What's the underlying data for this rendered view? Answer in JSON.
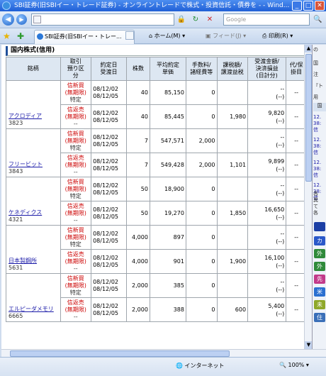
{
  "window": {
    "title": "SBI証券(旧SBIイー・トレード証券) - オンライントレードで株式・投資信託・債券を - - Wind...",
    "min_label": "_",
    "max_label": "□",
    "close_label": "✕"
  },
  "toolbar": {
    "back_icon": "◀",
    "forward_icon": "▶",
    "address_value": "",
    "lock_icon": "🔒",
    "refresh_icon": "↻",
    "stop_icon": "✕",
    "search_placeholder": "Google",
    "search_icon": "🔍"
  },
  "tabs": {
    "fav_star": "★",
    "fav_add": "✚",
    "active_tab_label": "SBI証券(旧SBIイー・トレー...",
    "home_label": "ホーム(M)",
    "feed_label": "フィード(J)",
    "print_label": "印刷(R)"
  },
  "section": {
    "title": "国内株式(信用)"
  },
  "table": {
    "headers": {
      "name": "銘柄",
      "kind": "取引\n預り区\n分",
      "date": "約定日\n受渡日",
      "qty": "株数",
      "avg": "平均約定\n単価",
      "fee": "手数料/\n諸経費等",
      "tax": "課税額/\n譲渡益税",
      "pl": "受渡金額/\n決済損益\n(日計分)",
      "agent": "代/保\n掛目"
    },
    "rows": [
      {
        "name": "アクロディア",
        "code": "3823",
        "kind1": "信新買",
        "kind2": "(無期限)",
        "kind3": "特定",
        "date1": "08/12/02",
        "date2": "08/12/05",
        "qty": "40",
        "avg": "85,150",
        "fee": "0",
        "tax": "",
        "pl1": "--",
        "pl2": "(--)",
        "agent": "--"
      },
      {
        "name": "",
        "code": "",
        "kind1": "信返売",
        "kind2": "(無期限)",
        "kind3": "--",
        "date1": "08/12/02",
        "date2": "08/12/05",
        "qty": "40",
        "avg": "85,445",
        "fee": "0",
        "tax": "1,980",
        "pl1": "9,820",
        "pl2": "(--)",
        "agent": "--"
      },
      {
        "name": "フリービット",
        "code": "3843",
        "kind1": "信新買",
        "kind2": "(無期限)",
        "kind3": "特定",
        "date1": "08/12/02",
        "date2": "08/12/05",
        "qty": "7",
        "avg": "547,571",
        "fee": "2,000",
        "tax": "",
        "pl1": "--",
        "pl2": "(--)",
        "agent": "--"
      },
      {
        "name": "",
        "code": "",
        "kind1": "信返売",
        "kind2": "(無期限)",
        "kind3": "--",
        "date1": "08/12/02",
        "date2": "08/12/05",
        "qty": "7",
        "avg": "549,428",
        "fee": "2,000",
        "tax": "1,101",
        "pl1": "9,899",
        "pl2": "(--)",
        "agent": "--"
      },
      {
        "name": "ケネディクス",
        "code": "4321",
        "kind1": "信新買",
        "kind2": "(無期限)",
        "kind3": "特定",
        "date1": "08/12/02",
        "date2": "08/12/05",
        "qty": "50",
        "avg": "18,900",
        "fee": "0",
        "tax": "",
        "pl1": "--",
        "pl2": "(--)",
        "agent": "--"
      },
      {
        "name": "",
        "code": "",
        "kind1": "信返売",
        "kind2": "(無期限)",
        "kind3": "--",
        "date1": "08/12/02",
        "date2": "08/12/05",
        "qty": "50",
        "avg": "19,270",
        "fee": "0",
        "tax": "1,850",
        "pl1": "16,650",
        "pl2": "(--)",
        "agent": "--"
      },
      {
        "name": "日本製鋼所",
        "code": "5631",
        "kind1": "信新買",
        "kind2": "(無期限)",
        "kind3": "特定",
        "date1": "08/12/02",
        "date2": "08/12/05",
        "qty": "4,000",
        "avg": "897",
        "fee": "0",
        "tax": "",
        "pl1": "--",
        "pl2": "(--)",
        "agent": "--"
      },
      {
        "name": "",
        "code": "",
        "kind1": "信返売",
        "kind2": "(無期限)",
        "kind3": "--",
        "date1": "08/12/02",
        "date2": "08/12/05",
        "qty": "4,000",
        "avg": "901",
        "fee": "0",
        "tax": "1,900",
        "pl1": "16,100",
        "pl2": "(--)",
        "agent": "--"
      },
      {
        "name": "エルピーダメモリ",
        "code": "6665",
        "kind1": "信新買",
        "kind2": "(無期限)",
        "kind3": "特定",
        "date1": "08/12/02",
        "date2": "08/12/05",
        "qty": "2,000",
        "avg": "385",
        "fee": "0",
        "tax": "",
        "pl1": "--",
        "pl2": "(--)",
        "agent": "--"
      },
      {
        "name": "",
        "code": "",
        "kind1": "信返売",
        "kind2": "(無期限)",
        "kind3": "--",
        "date1": "08/12/02",
        "date2": "08/12/05",
        "qty": "2,000",
        "avg": "388",
        "fee": "0",
        "tax": "600",
        "pl1": "5,400",
        "pl2": "(--)",
        "agent": "--"
      }
    ]
  },
  "right_pane": {
    "top_label": "の",
    "items": [
      "国",
      "注",
      "『ト",
      "用"
    ],
    "box_label": "国",
    "news": [
      "12.\n38:\n信",
      "12.\n38:\n信",
      "12.\n38:\n信",
      "12.\n38:\n信"
    ],
    "side_text": "各\n異\nて\n各",
    "buttons": [
      {
        "label": "カ",
        "color": "#2a58c9"
      },
      {
        "label": "外",
        "color": "#2f8a3a"
      },
      {
        "label": "外",
        "color": "#2f8a3a"
      },
      {
        "label": "先",
        "color": "#c23a8a"
      },
      {
        "label": "米",
        "color": "#2a6fd0"
      },
      {
        "label": "未",
        "color": "#8fa82a"
      },
      {
        "label": "住",
        "color": "#3a6fb8"
      }
    ]
  },
  "statusbar": {
    "zone_label": "インターネット",
    "zoom_label": "100%"
  }
}
